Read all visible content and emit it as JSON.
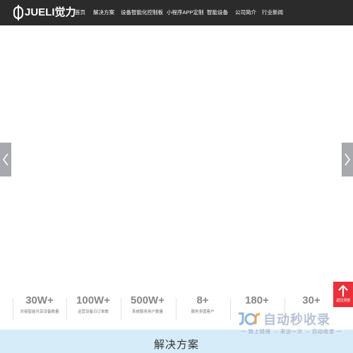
{
  "logo": {
    "text": "JUELI觉力"
  },
  "nav": {
    "items": [
      {
        "label": "首页"
      },
      {
        "label": "解决方案"
      },
      {
        "label": "设备智能化控制板"
      },
      {
        "label": "小程序APP定制"
      },
      {
        "label": "智能设备"
      },
      {
        "label": "公司简介"
      },
      {
        "label": "行业新闻"
      }
    ]
  },
  "carousel": {
    "prev_icon": "chevron-left-icon",
    "next_icon": "chevron-right-icon"
  },
  "stats": [
    {
      "value": "30W+",
      "label": "对接智能共享设备数量"
    },
    {
      "value": "100W+",
      "label": "运营设备日订单数"
    },
    {
      "value": "500W+",
      "label": "系统服务用户数量"
    },
    {
      "value": "8+",
      "label": "服务多国客户"
    },
    {
      "value": "180+",
      "label": ""
    },
    {
      "value": "30+",
      "label": ""
    }
  ],
  "back_to_top": {
    "label": "返回顶部",
    "icon": "arrow-up-icon"
  },
  "watermark": {
    "title": "自动秒收录",
    "subtitle": "一 致上链接 → 来访一次 → 自动收录 一"
  },
  "solutions": {
    "title": "解决方案"
  },
  "colors": {
    "header_bg": "#2b2b2b",
    "back_to_top": "#e8313a",
    "solutions_band": "#d6ecf8",
    "arrow_bg": "#a7a9ac"
  }
}
